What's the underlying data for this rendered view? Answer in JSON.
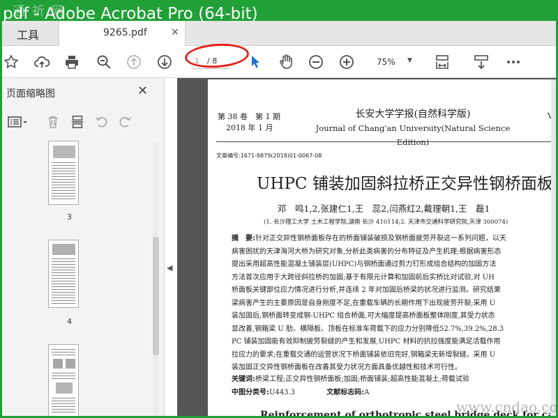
{
  "window": {
    "title": "pdf - Adobe Acrobat Pro (64-bit)",
    "title_watermark": "通 祈 网"
  },
  "tabs": {
    "tools_label": "工具",
    "doc_label": "9265.pdf",
    "close_glyph": "×"
  },
  "toolbar": {
    "page_current": "1",
    "page_total": "/ 8",
    "zoom": "75%",
    "icons": [
      "star-icon",
      "cloud-upload-icon",
      "print-icon",
      "zoom-search-icon",
      "prev-page-icon",
      "next-page-icon",
      "select-cursor-icon",
      "hand-icon",
      "zoom-out-icon",
      "zoom-in-icon",
      "fit-page-icon",
      "scroll-mode-icon",
      "more-icon"
    ],
    "accent": "#2a6fc9"
  },
  "panel": {
    "title": "页面缩略图",
    "close_glyph": "✕",
    "collapse_glyph": "◀",
    "thumbnails": [
      {
        "label": "3"
      },
      {
        "label": "4"
      },
      {
        "label": ""
      }
    ]
  },
  "document": {
    "header_left": [
      "第 38 卷　第 1 期",
      "2018 年 1 月"
    ],
    "header_center": [
      "长安大学学报(自然科学版)",
      "Journal of Chang'an University(Natural Science Edition)"
    ],
    "header_right": "Vo",
    "article_no": "文章编号:1671-8879(2018)01-0067-08",
    "title": "UHPC 铺装加固斜拉桥正交异性钢桥面板",
    "authors": "邓　鸣1,2,张建仁1,王　蕊2,闫燕红2,戴理朝1,王　磊1",
    "affiliation": "(1. 长沙理工大学 土木工程学院,湖南 长沙 410114;2. 天津市交通科学研究院,天津 300074)",
    "abstract_label": "摘　要:",
    "abstract_lines": [
      "针对正交异性钢桥面板存在的桥面铺装破损及钢桥面疲劳开裂这一系列问题，以天",
      "病害困扰的天津海河大桥为研究对象,分析此类病害的分布特征及产生机理;根据病害形态",
      "提出采用超高性能混凝土铺装层(UHPC)与钢桥面通过剪力钉形成组合结构的加固方法",
      "方法首次应用于大跨径斜拉桥的加固;基于有限元计算和加固前后实桥比对试验,对 UH",
      "桥面板关键部位应力情况进行分析,并连续 2 年对加固后桥梁的状况进行监测。研究结果",
      "梁病害产生的主要原因是自身刚度不足,在重载车辆的长期作用下出现疲劳开裂;采用 U",
      "装加固后,钢桥面转变成钢-UHPC 组合桥面,可大幅度提高桥面板整体刚度,其受力状态",
      "显改善,钢箱梁 U 肋、横隔板、顶板在标准车荷载下的应力分别降低52.7%,39.2%,28.3",
      "PC 铺装加固能有效抑制疲劳裂缝的产生和发展,UHPC 材料的抗拉强度能满足活载作用",
      "拉应力的要求;在重载交通的运营状况下桥面铺装依旧完好,钢箱梁无新增裂缝。采用 U",
      "装加固正交异性钢桥面板在改善其受力状况方面具备优越性和技术可行性。"
    ],
    "keywords_label": "关键词:",
    "keywords": "桥梁工程;正交异性钢桥面板;加固;桥面铺装;超高性能混凝土;荷载试验",
    "clc_label": "中图分类号:",
    "clc": "U443.3",
    "doc_code_label": "文献标志码:",
    "doc_code": "A",
    "english_title": "Reinforcement of orthotropic steel bridge deck for cable-stayed"
  },
  "site_watermark": "www.cndao.com",
  "colors": {
    "titlebar": "#21a038",
    "annotation": "#e2231a",
    "doc_bg": "#555555"
  }
}
